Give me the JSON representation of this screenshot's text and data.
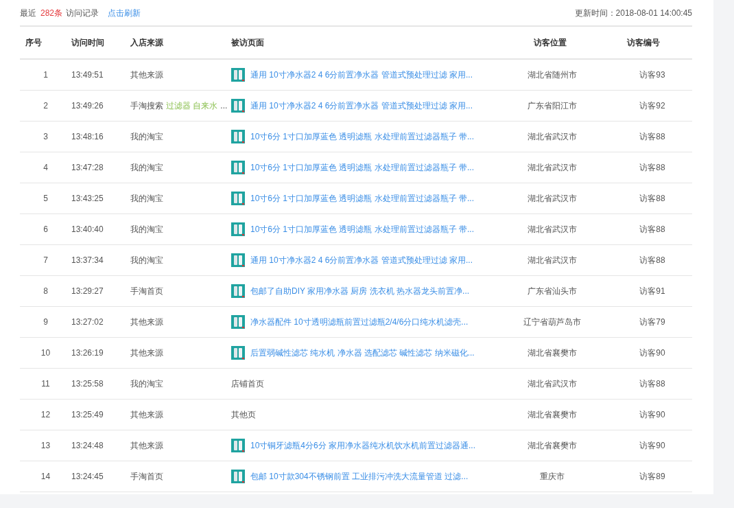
{
  "summary": {
    "prefix": "最近",
    "count": "282条",
    "suffix": "访问记录",
    "refresh_link": "点击刷新",
    "updated": "更新时间：2018-08-01 14:00:45"
  },
  "table": {
    "columns": [
      "序号",
      "访问时间",
      "入店来源",
      "被访页面",
      "访客位置",
      "访客编号"
    ],
    "rows": [
      {
        "index": "1",
        "time": "13:49:51",
        "source": "其他来源",
        "page": {
          "kind": "product",
          "title": "通用 10寸净水器2 4 6分前置净水器 管道式预处理过滤 家用..."
        },
        "location": "湖北省随州市",
        "visitor": "访客93"
      },
      {
        "index": "2",
        "time": "13:49:26",
        "source": "手淘搜索",
        "keywords": "过滤器 自来水",
        "more": "...",
        "page": {
          "kind": "product",
          "title": "通用 10寸净水器2 4 6分前置净水器 管道式预处理过滤 家用..."
        },
        "location": "广东省阳江市",
        "visitor": "访客92"
      },
      {
        "index": "3",
        "time": "13:48:16",
        "source": "我的淘宝",
        "page": {
          "kind": "product",
          "title": "10寸6分 1寸口加厚蓝色 透明滤瓶 水处理前置过滤器瓶子 带..."
        },
        "location": "湖北省武汉市",
        "visitor": "访客88"
      },
      {
        "index": "4",
        "time": "13:47:28",
        "source": "我的淘宝",
        "page": {
          "kind": "product",
          "title": "10寸6分 1寸口加厚蓝色 透明滤瓶 水处理前置过滤器瓶子 带..."
        },
        "location": "湖北省武汉市",
        "visitor": "访客88"
      },
      {
        "index": "5",
        "time": "13:43:25",
        "source": "我的淘宝",
        "page": {
          "kind": "product",
          "title": "10寸6分 1寸口加厚蓝色 透明滤瓶 水处理前置过滤器瓶子 带..."
        },
        "location": "湖北省武汉市",
        "visitor": "访客88"
      },
      {
        "index": "6",
        "time": "13:40:40",
        "source": "我的淘宝",
        "page": {
          "kind": "product",
          "title": "10寸6分 1寸口加厚蓝色 透明滤瓶 水处理前置过滤器瓶子 带..."
        },
        "location": "湖北省武汉市",
        "visitor": "访客88"
      },
      {
        "index": "7",
        "time": "13:37:34",
        "source": "我的淘宝",
        "page": {
          "kind": "product",
          "title": "通用 10寸净水器2 4 6分前置净水器 管道式预处理过滤 家用..."
        },
        "location": "湖北省武汉市",
        "visitor": "访客88"
      },
      {
        "index": "8",
        "time": "13:29:27",
        "source": "手淘首页",
        "page": {
          "kind": "product",
          "title": "包邮了自助DIY 家用净水器 厨房 洗衣机 热水器龙头前置净..."
        },
        "location": "广东省汕头市",
        "visitor": "访客91"
      },
      {
        "index": "9",
        "time": "13:27:02",
        "source": "其他来源",
        "page": {
          "kind": "product",
          "title": "净水器配件 10寸透明滤瓶前置过滤瓶2/4/6分口纯水机滤壳..."
        },
        "location": "辽宁省葫芦岛市",
        "visitor": "访客79"
      },
      {
        "index": "10",
        "time": "13:26:19",
        "source": "其他来源",
        "page": {
          "kind": "product",
          "title": "后置弱碱性滤芯 纯水机 净水器 选配滤芯 碱性滤芯 纳米磁化..."
        },
        "location": "湖北省襄樊市",
        "visitor": "访客90"
      },
      {
        "index": "11",
        "time": "13:25:58",
        "source": "我的淘宝",
        "page": {
          "kind": "plain",
          "title": "店铺首页"
        },
        "location": "湖北省武汉市",
        "visitor": "访客88"
      },
      {
        "index": "12",
        "time": "13:25:49",
        "source": "其他来源",
        "page": {
          "kind": "plain",
          "title": "其他页"
        },
        "location": "湖北省襄樊市",
        "visitor": "访客90"
      },
      {
        "index": "13",
        "time": "13:24:48",
        "source": "其他来源",
        "page": {
          "kind": "product",
          "title": "10寸铜牙滤瓶4分6分 家用净水器纯水机饮水机前置过滤器通..."
        },
        "location": "湖北省襄樊市",
        "visitor": "访客90"
      },
      {
        "index": "14",
        "time": "13:24:45",
        "source": "手淘首页",
        "page": {
          "kind": "product",
          "title": "包邮 10寸款304不锈钢前置 工业排污冲洗大流量管道 过滤..."
        },
        "location": "重庆市",
        "visitor": "访客89"
      }
    ]
  }
}
